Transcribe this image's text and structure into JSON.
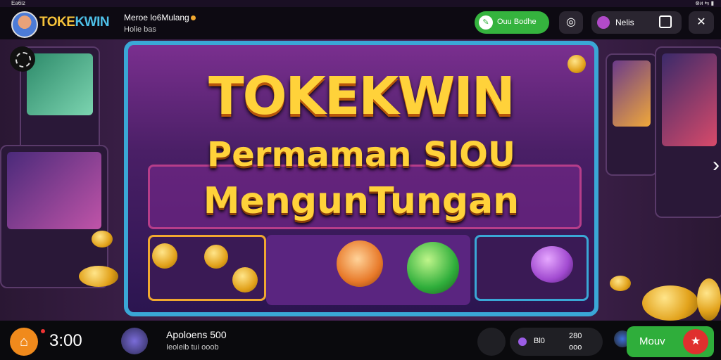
{
  "status_bar": {
    "left": "Ea6iz",
    "right": "⊗ᴎ ⇆ ▮"
  },
  "header": {
    "brand_main": "TOKE",
    "brand_accent": "KWIN",
    "info_title": "Meroe lo6Mulang",
    "info_sub": "Holie bas",
    "green_pill": "Ouu Bodhe",
    "dark_pill": "Nelis"
  },
  "banner": {
    "title_line1": "TOKEKWIN",
    "title_line2": "Permaman SlOU",
    "title_line3": "MengunTungan"
  },
  "footer": {
    "time": "3:00",
    "app_title": "Apoloens 500",
    "app_sub": "Ieoleib tui ooob",
    "stat_label": "Bl0",
    "stat_top": "280",
    "stat_bottom": "ooo",
    "move_button": "Mouv"
  },
  "colors": {
    "accent": "#ffd23a",
    "green": "#35b33e",
    "frame": "#3aa7d6",
    "home": "#f08a1c"
  }
}
